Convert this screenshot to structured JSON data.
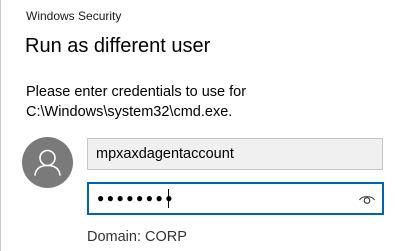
{
  "window": {
    "title": "Windows Security"
  },
  "dialog": {
    "heading": "Run as different user",
    "message": "Please enter credentials to use for C:\\Windows\\system32\\cmd.exe.",
    "username": "mpxaxdagentaccount",
    "password_masked": "●●●●●●●●",
    "domain_text": "Domain: CORP"
  },
  "icons": {
    "avatar": "user-avatar-icon",
    "reveal": "eye-icon"
  },
  "colors": {
    "accent": "#0063b1",
    "avatar_bg": "#7a7a7a",
    "field_bg": "#f0f0f0"
  }
}
